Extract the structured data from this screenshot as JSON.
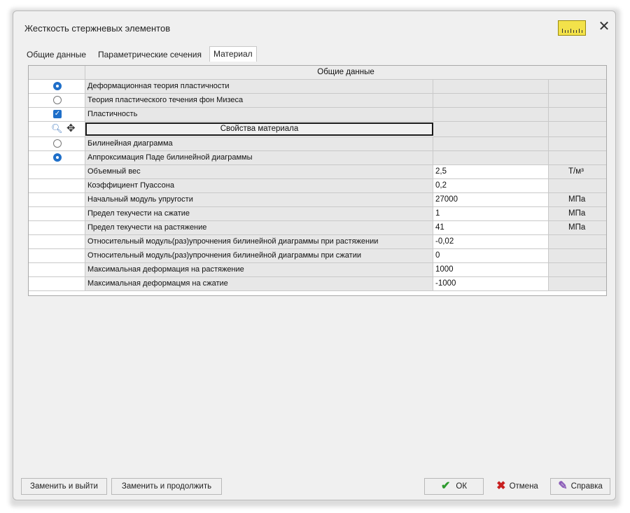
{
  "window": {
    "title": "Жесткость стержневых элементов",
    "close_glyph": "✕"
  },
  "tabs": [
    {
      "label": "Общие данные"
    },
    {
      "label": "Параметрические сечения"
    },
    {
      "label": "Материал"
    }
  ],
  "grid": {
    "section_header": "Общие данные",
    "theory_rows": [
      {
        "label": "Деформационная теория пластичности",
        "state": "selected"
      },
      {
        "label": "Теория пластического течения фон Мизеса",
        "state": "unselected"
      },
      {
        "label": "Пластичность",
        "state": "checked"
      }
    ],
    "material_props_label": "Свойства материала",
    "diagram_rows": [
      {
        "label": "Билинейная диаграмма",
        "state": "unselected"
      },
      {
        "label": "Аппроксимация Паде билинейной диаграммы",
        "state": "selected"
      }
    ],
    "params": [
      {
        "label": "Объемный вес",
        "value": "2,5",
        "unit": "Т/м³"
      },
      {
        "label": "Коэффициент Пуассона",
        "value": "0,2",
        "unit": ""
      },
      {
        "label": "Начальный модуль упругости",
        "value": "27000",
        "unit": "МПа"
      },
      {
        "label": "Предел текучести на сжатие",
        "value": "1",
        "unit": "МПа"
      },
      {
        "label": "Предел текучести на растяжение",
        "value": "41",
        "unit": "МПа"
      },
      {
        "label": "Относительный модуль(раз)упрочнения билинейной диаграммы при растяжении",
        "value": "-0,02",
        "unit": ""
      },
      {
        "label": "Относительный модуль(раз)упрочнения билинейной диаграммы при сжатии",
        "value": "0",
        "unit": ""
      },
      {
        "label": "Максимальная деформация на растяжение",
        "value": "1000",
        "unit": ""
      },
      {
        "label": "Максимальная деформацмя на сжатие",
        "value": "-1000",
        "unit": ""
      }
    ]
  },
  "buttons": {
    "replace_exit": "Заменить и выйти",
    "replace_continue": "Заменить и продолжить",
    "ok": "ОК",
    "cancel": "Отмена",
    "help": "Справка"
  },
  "icons": {
    "ok": "check-icon",
    "cancel": "cross-icon",
    "help": "help-book-icon",
    "ruler": "ruler-icon",
    "search": "magnifier-icon",
    "move": "move-icon"
  },
  "colors": {
    "radio": "#1f6fc9",
    "ok_green": "#2e9b2e",
    "cancel_red": "#c8201f"
  }
}
